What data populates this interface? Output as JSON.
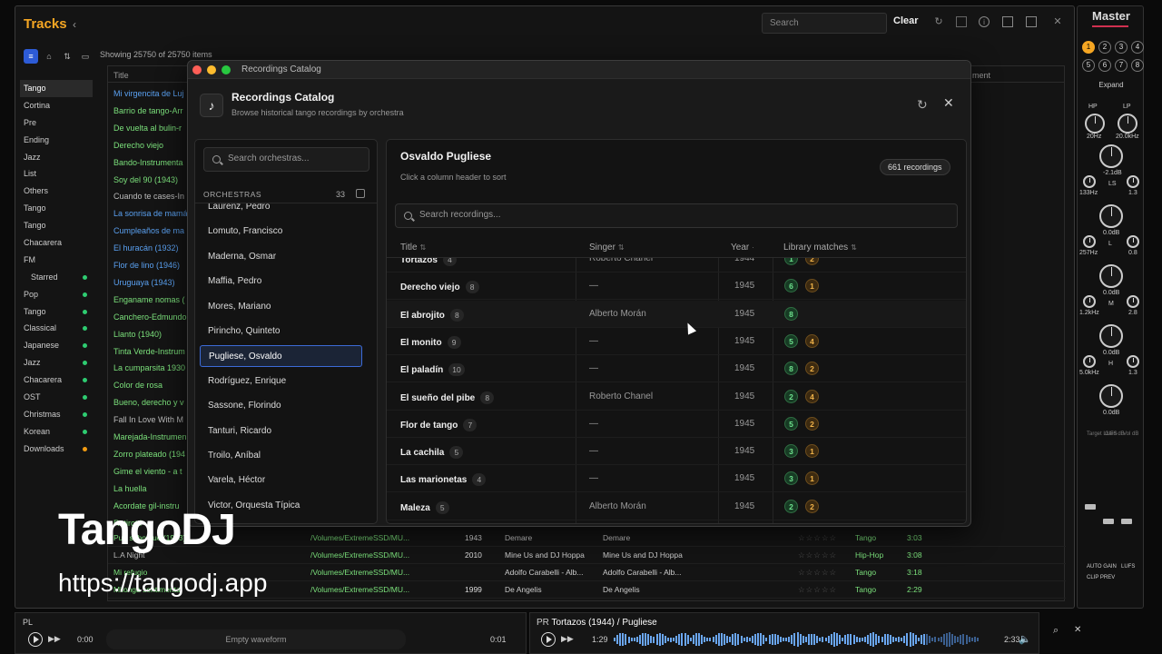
{
  "app": {
    "title": "Tracks",
    "showing": "Showing 25750 of 25750 items",
    "search_placeholder": "Search",
    "clear_label": "Clear"
  },
  "sidebar": [
    {
      "label": "Tango",
      "selected": true,
      "dot": ""
    },
    {
      "label": "Cortina",
      "dot": ""
    },
    {
      "label": "Pre",
      "dot": ""
    },
    {
      "label": "Ending",
      "dot": ""
    },
    {
      "label": "Jazz",
      "dot": ""
    },
    {
      "label": "List",
      "dot": ""
    },
    {
      "label": "Others",
      "dot": ""
    },
    {
      "label": "Tango",
      "dot": ""
    },
    {
      "label": "Tango",
      "dot": ""
    },
    {
      "label": "Chacarera",
      "dot": ""
    },
    {
      "label": "FM",
      "dot": ""
    },
    {
      "label": "Starred",
      "dot": "#2ecc71"
    },
    {
      "label": "Pop",
      "dot": "#2ecc71"
    },
    {
      "label": "Tango",
      "dot": "#2ecc71"
    },
    {
      "label": "Classical",
      "dot": "#2ecc71"
    },
    {
      "label": "Japanese",
      "dot": "#2ecc71"
    },
    {
      "label": "Jazz",
      "dot": "#2ecc71"
    },
    {
      "label": "Chacarera",
      "dot": "#2ecc71"
    },
    {
      "label": "OST",
      "dot": "#2ecc71"
    },
    {
      "label": "Christmas",
      "dot": "#2ecc71"
    },
    {
      "label": "Korean",
      "dot": "#2ecc71"
    },
    {
      "label": "Downloads",
      "dot": "#f39c12"
    }
  ],
  "track_header": {
    "title": "Title",
    "comment": "ment"
  },
  "tracks_left": [
    {
      "t": "Mi virgencita de Luj",
      "c": "#5aa0f0"
    },
    {
      "t": "Barrio de tango-Arr",
      "c": "#7be07b"
    },
    {
      "t": "De vuelta al bulin-r",
      "c": "#7be07b"
    },
    {
      "t": "Derecho viejo",
      "c": "#7be07b"
    },
    {
      "t": "Bando-Instrumenta",
      "c": "#7be07b"
    },
    {
      "t": "Soy del 90 (1943)",
      "c": "#7be07b"
    },
    {
      "t": "Cuando te cases-In",
      "c": "#bbbbbb"
    },
    {
      "t": "La sonrisa de mamá",
      "c": "#5aa0f0"
    },
    {
      "t": "Cumpleaños de ma",
      "c": "#5aa0f0"
    },
    {
      "t": "El huracán (1932)",
      "c": "#5aa0f0"
    },
    {
      "t": "Flor de lino (1946)",
      "c": "#5aa0f0"
    },
    {
      "t": "Uruguaya (1943)",
      "c": "#5aa0f0"
    },
    {
      "t": "Enganame nomas (",
      "c": "#7be07b"
    },
    {
      "t": "Canchero-Edmundo",
      "c": "#7be07b"
    },
    {
      "t": "Llanto (1940)",
      "c": "#7be07b"
    },
    {
      "t": "Tinta Verde-Instrum",
      "c": "#7be07b"
    },
    {
      "t": "La cumparsita 1930",
      "c": "#7be07b"
    },
    {
      "t": "Color de rosa",
      "c": "#7be07b"
    },
    {
      "t": "Bueno, derecho y v",
      "c": "#7be07b"
    },
    {
      "t": "Fall In Love With M",
      "c": "#bbbbbb"
    },
    {
      "t": "Marejada-Instrumen",
      "c": "#7be07b"
    },
    {
      "t": "Zorro plateado (194",
      "c": "#7be07b"
    },
    {
      "t": "Gime el viento - a t",
      "c": "#7be07b"
    },
    {
      "t": "La huella",
      "c": "#7be07b"
    },
    {
      "t": "Acordate gil-instru",
      "c": "#7be07b"
    },
    {
      "t": "Retirotti",
      "c": "#7be07b"
    }
  ],
  "tracks_full": [
    {
      "title": "Pue sabo que (1943)",
      "path": "/Volumes/ExtremeSSD/MU...",
      "year": "1943",
      "artist": "Demare",
      "album": "Demare",
      "genre": "Tango",
      "time": "3:03",
      "c": "#7be07b"
    },
    {
      "title": "L.A Night",
      "path": "/Volumes/ExtremeSSD/MU...",
      "year": "2010",
      "artist": "Mine Us and DJ Hoppa",
      "album": "Mine Us and DJ Hoppa",
      "genre": "Hip-Hop",
      "time": "3:08",
      "c": "#bbbbbb"
    },
    {
      "title": "Mi refugio",
      "path": "/Volumes/ExtremeSSD/MU...",
      "year": "",
      "artist": "Adolfo Carabelli - Alb...",
      "album": "Adolfo Carabelli - Alb...",
      "genre": "Tango",
      "time": "3:18",
      "c": "#7be07b"
    },
    {
      "title": "Milonga sentimental",
      "path": "/Volumes/ExtremeSSD/MU...",
      "year": "1999",
      "artist": "De Angelis",
      "album": "De Angelis",
      "genre": "Tango",
      "time": "2:29",
      "c": "#7be07b"
    }
  ],
  "dialog": {
    "window_title": "Recordings Catalog",
    "title": "Recordings Catalog",
    "subtitle": "Browse historical tango recordings by orchestra",
    "icon": "music-note-icon",
    "orch_search_placeholder": "Search orchestras...",
    "orch_header": "ORCHESTRAS",
    "orch_count": "33",
    "orchestras": [
      {
        "name": "Laurenz, Pedro"
      },
      {
        "name": "Lomuto, Francisco"
      },
      {
        "name": "Maderna, Osmar"
      },
      {
        "name": "Maffia, Pedro"
      },
      {
        "name": "Mores, Mariano"
      },
      {
        "name": "Pirincho, Quinteto"
      },
      {
        "name": "Pugliese, Osvaldo",
        "selected": true
      },
      {
        "name": "Rodríguez, Enrique"
      },
      {
        "name": "Sassone, Florindo"
      },
      {
        "name": "Tanturi, Ricardo"
      },
      {
        "name": "Troilo, Aníbal"
      },
      {
        "name": "Varela, Héctor"
      },
      {
        "name": "Victor, Orquesta Típica"
      }
    ],
    "selected_orchestra": "Osvaldo Pugliese",
    "sort_hint": "Click a column header to sort",
    "recording_badge": "661 recordings",
    "rec_search_placeholder": "Search recordings...",
    "columns": {
      "title": "Title",
      "singer": "Singer",
      "year": "Year",
      "matches": "Library matches"
    },
    "recordings": [
      {
        "title": "Tortazos",
        "count": "4",
        "singer": "Roberto Chanel",
        "year": "1944",
        "g": "1",
        "o": "2"
      },
      {
        "title": "Derecho viejo",
        "count": "8",
        "singer": "—",
        "year": "1945",
        "g": "6",
        "o": "1"
      },
      {
        "title": "El abrojito",
        "count": "8",
        "singer": "Alberto Morán",
        "year": "1945",
        "g": "8",
        "o": ""
      },
      {
        "title": "El monito",
        "count": "9",
        "singer": "—",
        "year": "1945",
        "g": "5",
        "o": "4"
      },
      {
        "title": "El paladín",
        "count": "10",
        "singer": "—",
        "year": "1945",
        "g": "8",
        "o": "2"
      },
      {
        "title": "El sueño del pibe",
        "count": "8",
        "singer": "Roberto Chanel",
        "year": "1945",
        "g": "2",
        "o": "4"
      },
      {
        "title": "Flor de tango",
        "count": "7",
        "singer": "—",
        "year": "1945",
        "g": "5",
        "o": "2"
      },
      {
        "title": "La cachila",
        "count": "5",
        "singer": "—",
        "year": "1945",
        "g": "3",
        "o": "1"
      },
      {
        "title": "Las marionetas",
        "count": "4",
        "singer": "—",
        "year": "1945",
        "g": "3",
        "o": "1"
      },
      {
        "title": "Maleza",
        "count": "5",
        "singer": "Alberto Morán",
        "year": "1945",
        "g": "2",
        "o": "2"
      }
    ]
  },
  "master": {
    "title": "Master",
    "channels": [
      "1",
      "2",
      "3",
      "4",
      "5",
      "6",
      "7",
      "8"
    ],
    "expand": "Expand",
    "hp": "HP",
    "lp": "LP",
    "hp_val": "20Hz",
    "lp_val": "20.0kHz",
    "eq": [
      {
        "gain": "-2.1dB",
        "band": "LS",
        "freq": "133Hz",
        "q": "1.3"
      },
      {
        "gain": "0.0dB",
        "band": "L",
        "freq": "257Hz",
        "q": "0.8"
      },
      {
        "gain": "0.0dB",
        "band": "M",
        "freq": "1.2kHz",
        "q": "2.8"
      },
      {
        "gain": "0.0dB",
        "band": "H",
        "freq": "5.0kHz",
        "q": "1.3"
      },
      {
        "gain": "0.0dB",
        "band": "",
        "freq": "",
        "q": ""
      }
    ],
    "meter_hdr": [
      "Target LUFS",
      "Gain dB",
      "Vol dB"
    ],
    "auto_gain": "AUTO GAIN",
    "lufs": "LUFS",
    "clip_prev": "CLIP PREV"
  },
  "player_left": {
    "label": "PL",
    "time_start": "0:00",
    "waveform": "Empty waveform",
    "time_end": "0:01"
  },
  "player_right": {
    "prefix": "PR",
    "track": "Tortazos (1944)",
    "sep": "/",
    "artist": "Pugliese",
    "time_start": "1:29",
    "time_end": "2:33"
  },
  "watermark": {
    "brand": "TangoDJ",
    "url": "https://tangodj.app"
  }
}
